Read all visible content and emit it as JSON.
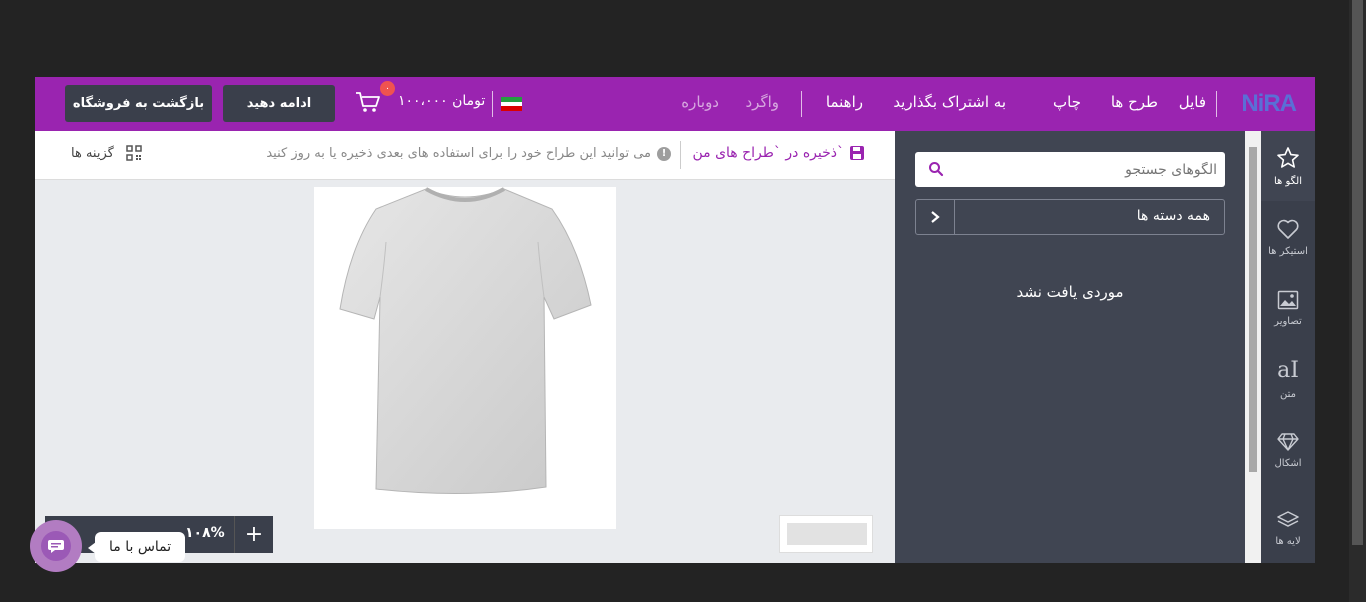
{
  "header": {
    "logo": "NiRA",
    "menu": [
      "فایل",
      "طرح ها",
      "چاپ",
      "به اشتراک بگذارید",
      "راهنما"
    ],
    "undo": "واگرد",
    "redo": "دوباره",
    "price": "۱۰۰،۰۰۰ تومان",
    "cart_count": "۰",
    "continue_button": "ادامه دهید",
    "back_button": "بازگشت به فروشگاه"
  },
  "toolbar": {
    "save_label": "ذخیره در `طراح های من`",
    "hint": "می توانید این طراح خود را برای استفاده های بعدی ذخیره یا به روز کنید",
    "options_label": "گزینه ها"
  },
  "panel": {
    "search_placeholder": "الگوهای جستجو",
    "category": "همه دسته ها",
    "empty_text": "موردی یافت نشد"
  },
  "sidebar": {
    "items": [
      {
        "label": "الگو ها",
        "icon": "star-icon"
      },
      {
        "label": "استیکر ها",
        "icon": "heart-icon"
      },
      {
        "label": "تصاویر",
        "icon": "image-icon"
      },
      {
        "label": "متن",
        "icon": "text-icon"
      },
      {
        "label": "اشکال",
        "icon": "diamond-icon"
      },
      {
        "label": "لایه ها",
        "icon": "layers-icon"
      }
    ]
  },
  "zoom": {
    "value": "۱۰۸%",
    "plus": "+"
  },
  "contact": {
    "label": "تماس با ما"
  },
  "colors": {
    "brand": "#9a24b0",
    "dark": "#3a3f4b",
    "panel": "#404552"
  }
}
